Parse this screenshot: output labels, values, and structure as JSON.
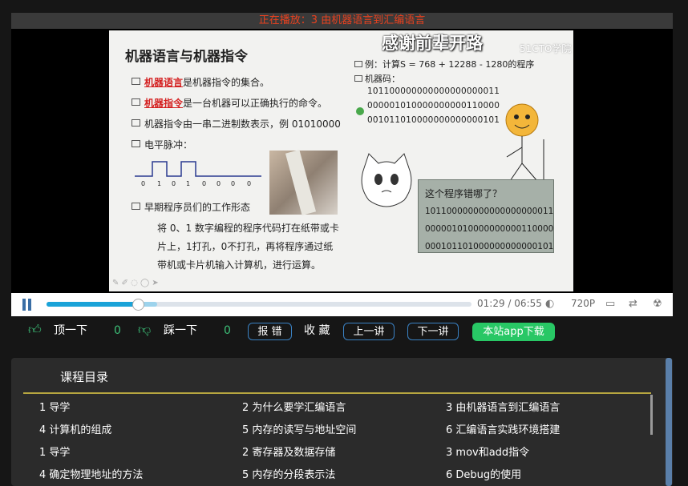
{
  "now_playing": "正在播放：3 由机器语言到汇编语言",
  "slide": {
    "banner": "感谢前辈开路",
    "watermark": "51CTO学院",
    "title": "机器语言与机器指令",
    "bullets": [
      {
        "red": "机器语言",
        "text": "是机器指令的集合。"
      },
      {
        "red": "机器指令",
        "text": "是一台机器可以正确执行的命令。"
      },
      {
        "red": "",
        "text": "机器指令由一串二进制数表示，例 01010000"
      },
      {
        "red": "",
        "text": "电平脉冲："
      },
      {
        "red": "",
        "text": "早期程序员们的工作形态"
      }
    ],
    "pulse_bits": [
      "0",
      "1",
      "0",
      "1",
      "0",
      "0",
      "0",
      "0"
    ],
    "paragraph": "将 0、1 数字编程的程序代码打在纸带或卡片上，1打孔，0不打孔，再将程序通过纸带机或卡片机输入计算机，进行运算。",
    "example_label": "例：计算S = 768 + 12288 - 1280的程序",
    "machine_code_label": "机器码：",
    "machine_code": [
      "101100000000000000000011",
      "000001010000000000110000",
      "001011010000000000000101"
    ],
    "bubble_question": "这个程序错哪了？",
    "bubble_code": [
      "101100000000000000000011",
      "000001010000000000110000",
      "000101101000000000000101"
    ]
  },
  "player": {
    "current_time": "01:29",
    "separator": "/",
    "duration": "06:55",
    "quality": "720P",
    "progress": 0.215,
    "buffered": 0.26
  },
  "actions": {
    "like_label": "顶一下",
    "like_count": "0",
    "dislike_label": "踩一下",
    "dislike_count": "0",
    "report": "报 错",
    "favorite": "收 藏",
    "prev": "上一讲",
    "next": "下一讲",
    "app_download": "本站app下载"
  },
  "catalog": {
    "title": "课程目录",
    "rows": [
      [
        "1 导学",
        "2 为什么要学汇编语言",
        "3 由机器语言到汇编语言"
      ],
      [
        "4 计算机的组成",
        "5 内存的读写与地址空间",
        "6 汇编语言实践环境搭建"
      ],
      [
        "1 导学",
        "2 寄存器及数据存储",
        "3 mov和add指令"
      ],
      [
        "4 确定物理地址的方法",
        "5 内存的分段表示法",
        "6 Debug的使用"
      ]
    ]
  },
  "colors": {
    "accent_blue": "#1aa3d8",
    "green": "#28c765",
    "now_playing_red": "#e8411f"
  }
}
